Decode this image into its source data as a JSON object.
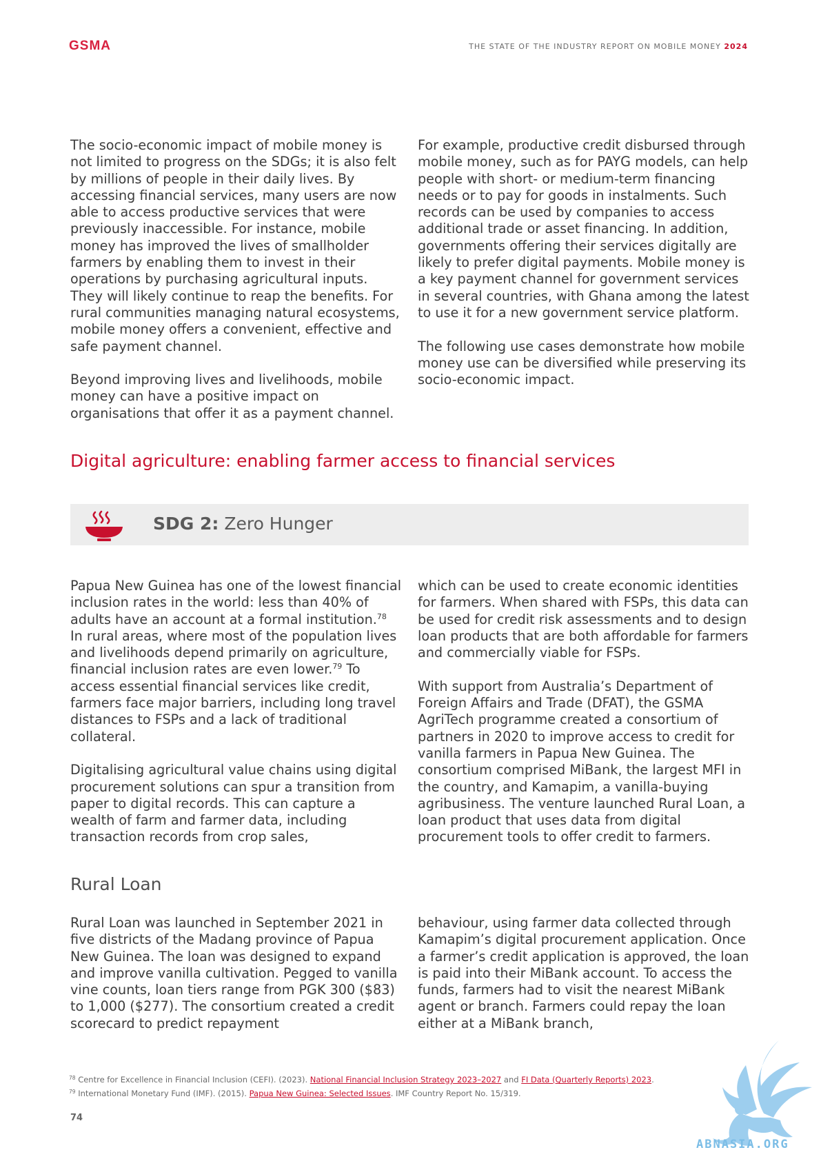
{
  "header": {
    "logo": "GSMA",
    "report_title": "THE STATE OF THE INDUSTRY REPORT ON MOBILE MONEY",
    "report_year": "2024"
  },
  "intro": {
    "left": [
      "The socio-economic impact of mobile money is not limited to progress on the SDGs; it is also felt by millions of people in their daily lives. By accessing financial services, many users are now able to access productive services that were previously inaccessible. For instance, mobile money has improved the lives of smallholder farmers by enabling them to invest in their operations by purchasing agricultural inputs. They will likely continue to reap the benefits. For rural communities managing natural ecosystems, mobile money offers a convenient, effective and safe payment channel.",
      "Beyond improving lives and livelihoods, mobile money can have a positive impact on organisations that offer it as a payment channel."
    ],
    "right": [
      "For example, productive credit disbursed through mobile money, such as for PAYG models, can help people with short- or medium-term financing needs or to pay for goods in instalments. Such records can be used by companies to access additional trade or asset financing. In addition, governments offering their services digitally are likely to prefer digital payments. Mobile money is a key payment channel for government services in several countries, with Ghana among the latest to use it for a new government service platform.",
      "The following use cases demonstrate how mobile money use can be diversified while preserving its socio-economic impact."
    ]
  },
  "section": {
    "title": "Digital agriculture: enabling farmer access to financial services",
    "sdg_label": "SDG 2:",
    "sdg_name": "Zero Hunger",
    "sdg_icon": "bowl-icon",
    "icon_color": "#c8102e"
  },
  "agri": {
    "left": {
      "p1_a": "Papua New Guinea has one of the lowest financial inclusion rates in the world: less than 40% of adults have an account at a formal institution.",
      "fn78": "78",
      "p1_b": " In rural areas, where most of the population lives and livelihoods depend primarily on agriculture, financial inclusion rates are even lower.",
      "fn79": "79",
      "p1_c": " To access essential financial services like credit, farmers face major barriers, including long travel distances to FSPs and a lack of traditional collateral.",
      "p2": "Digitalising agricultural value chains using digital procurement solutions can spur a transition from paper to digital records. This can capture a wealth of farm and farmer data, including transaction records from crop sales,"
    },
    "right": [
      "which can be used to create economic identities for farmers. When shared with FSPs, this data can be used for credit risk assessments and to design loan products that are both affordable for farmers and commercially viable for FSPs.",
      "With support from Australia’s Department of Foreign Affairs and Trade (DFAT), the GSMA AgriTech programme created a consortium of partners in 2020 to improve access to credit for vanilla farmers in Papua New Guinea. The consortium comprised MiBank, the largest MFI in the country, and Kamapim, a vanilla-buying agribusiness. The venture launched Rural Loan, a loan product that uses data from digital procurement tools to offer credit to farmers."
    ]
  },
  "rural": {
    "title": "Rural Loan",
    "left": "Rural Loan was launched in September 2021 in five districts of the Madang province of Papua New Guinea. The loan was designed to expand and improve vanilla cultivation. Pegged to vanilla vine counts, loan tiers range from PGK 300 ($83) to 1,000 ($277). The consortium created a credit scorecard to predict repayment",
    "right": "behaviour, using farmer data collected through Kamapim’s digital procurement application. Once a farmer’s credit application is approved, the loan is paid into their MiBank account. To access the funds, farmers had to visit the nearest MiBank agent or branch. Farmers could repay the loan either at a MiBank branch,"
  },
  "footnotes": {
    "fn78": {
      "num": "78",
      "pre": " Centre for Excellence in Financial Inclusion (CEFI). (2023). ",
      "link1": "National Financial Inclusion Strategy 2023–2027",
      "mid": " and ",
      "link2": "FI Data (Quarterly Reports) 2023",
      "post": "."
    },
    "fn79": {
      "num": "79",
      "pre": " International Monetary Fund (IMF). (2015). ",
      "link": "Papua New Guinea: Selected Issues",
      "post": ". IMF Country Report No. 15/319."
    }
  },
  "page_number": "74",
  "watermark": {
    "text": "ABNASIA.ORG",
    "color": "#7bbde6"
  }
}
